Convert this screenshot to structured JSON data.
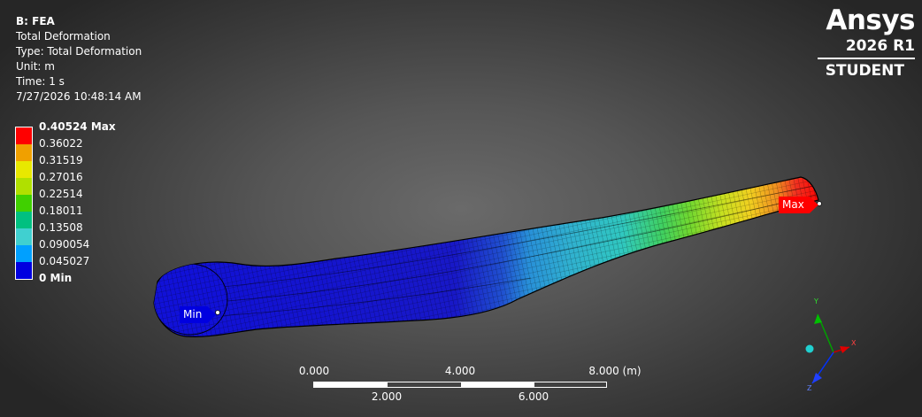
{
  "info": {
    "title": "B: FEA",
    "lines": [
      "Total Deformation",
      "Type: Total Deformation",
      "Unit: m",
      "Time: 1 s",
      "7/27/2026 10:48:14 AM"
    ]
  },
  "legend": {
    "colors": [
      "#ff0000",
      "#f0a000",
      "#e8e800",
      "#b0e000",
      "#40d000",
      "#00c080",
      "#40d0d0",
      "#00a0ff",
      "#0000e0"
    ],
    "values": [
      "0.40524 Max",
      "0.36022",
      "0.31519",
      "0.27016",
      "0.22514",
      "0.18011",
      "0.13508",
      "0.090054",
      "0.045027",
      "0 Min"
    ]
  },
  "logo": {
    "brand": "Ansys",
    "version": "2026 R1",
    "edition": "STUDENT"
  },
  "probes": {
    "min": "Min",
    "max": "Max"
  },
  "scale_bar": {
    "top_labels": [
      "0.000",
      "4.000",
      "8.000 (m)"
    ],
    "bottom_labels": [
      "2.000",
      "6.000"
    ]
  },
  "triad": {
    "y_label": "Y",
    "x_label": "X",
    "z_label": "Z"
  }
}
